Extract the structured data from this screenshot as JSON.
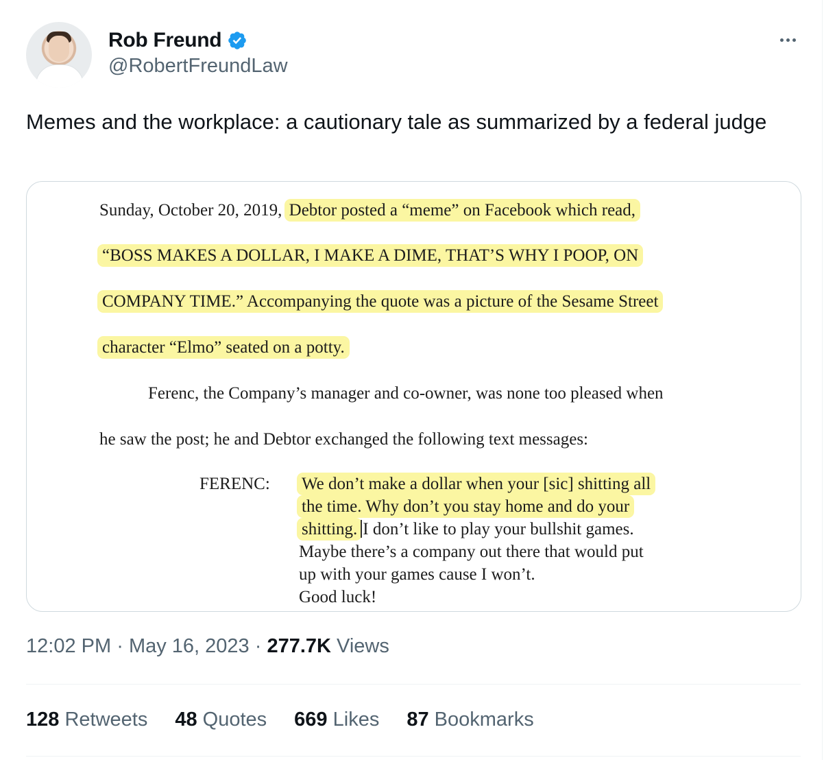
{
  "author": {
    "display_name": "Rob Freund",
    "handle": "@RobertFreundLaw",
    "verified": true,
    "avatar_icon": "profile-photo"
  },
  "tweet": {
    "text": "Memes and the workplace: a cautionary tale as summarized by a federal judge",
    "time": "12:02 PM",
    "date": "May 16, 2023",
    "views_count": "277.7K",
    "views_label": "Views",
    "separator": "·"
  },
  "document": {
    "line1_plain": "Sunday, October 20, 2019, ",
    "line1_highlight": "Debtor posted a “meme” on Facebook which read,",
    "line2": "“BOSS MAKES A DOLLAR, I MAKE A DIME, THAT’S WHY I POOP, ON",
    "line3": "COMPANY TIME.”  Accompanying the quote was a picture of the Sesame Street",
    "line4": "character “Elmo” seated on a potty.",
    "line5": "Ferenc, the Company’s manager and co-owner, was none too pleased when",
    "line6": "he saw the post; he and Debtor exchanged the following text messages:",
    "speaker": "FERENC:",
    "msg1": "We don’t make a dollar when your [sic] shitting all",
    "msg2": "the time.  Why don’t you stay home and do your",
    "msg3_highlight": "shitting.",
    "msg3_plain": "I don’t like to play your bullshit games.",
    "msg4": "Maybe there’s a company out there that would put",
    "msg5": "up with your games cause I won’t.",
    "msg6": "Good luck!",
    "highlight_color": "#fbf6a2"
  },
  "stats": [
    {
      "count": "128",
      "label": "Retweets"
    },
    {
      "count": "48",
      "label": "Quotes"
    },
    {
      "count": "669",
      "label": "Likes"
    },
    {
      "count": "87",
      "label": "Bookmarks"
    }
  ],
  "colors": {
    "text": "#0f1419",
    "secondary": "#536471",
    "verified_blue": "#1d9bf0",
    "border": "#cfd9de"
  }
}
